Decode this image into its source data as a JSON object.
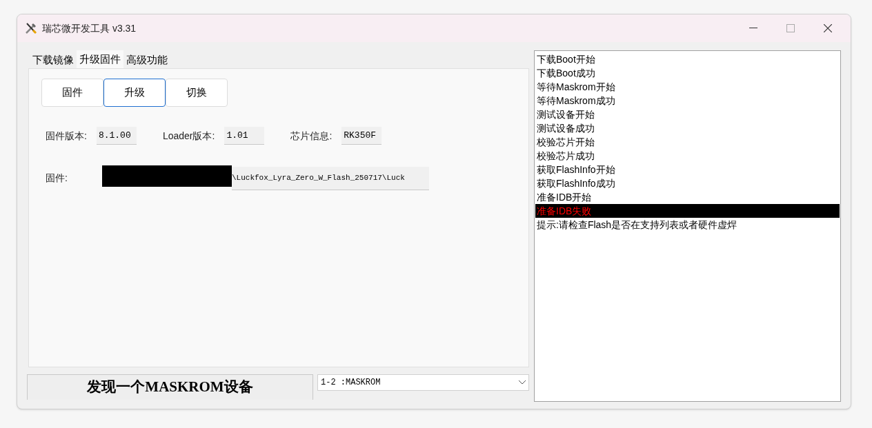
{
  "window": {
    "title": "瑞芯微开发工具 v3.31"
  },
  "tabs": [
    {
      "label": "下载镜像",
      "selected": false
    },
    {
      "label": "升级固件",
      "selected": true
    },
    {
      "label": "高级功能",
      "selected": false
    }
  ],
  "buttons": [
    {
      "label": "固件",
      "selected": false
    },
    {
      "label": "升级",
      "selected": true
    },
    {
      "label": "切换",
      "selected": false
    }
  ],
  "info": [
    {
      "label": "固件版本:",
      "value": "8.1.00"
    },
    {
      "label": "Loader版本:",
      "value": "1.01"
    },
    {
      "label": "芯片信息:",
      "value": "RK350F"
    }
  ],
  "firmware": {
    "label": "固件:",
    "value": "\\Luckfox_Lyra_Zero_W_Flash_250717\\Luck"
  },
  "status": "发现一个MASKROM设备",
  "device_select": {
    "value": "1-2 :MASKROM"
  },
  "log": [
    {
      "text": "下载Boot开始",
      "selected": false,
      "color": "#000000"
    },
    {
      "text": "下载Boot成功",
      "selected": false,
      "color": "#000000"
    },
    {
      "text": "等待Maskrom开始",
      "selected": false,
      "color": "#000000"
    },
    {
      "text": "等待Maskrom成功",
      "selected": false,
      "color": "#000000"
    },
    {
      "text": "测试设备开始",
      "selected": false,
      "color": "#000000"
    },
    {
      "text": "测试设备成功",
      "selected": false,
      "color": "#000000"
    },
    {
      "text": "校验芯片开始",
      "selected": false,
      "color": "#000000"
    },
    {
      "text": "校验芯片成功",
      "selected": false,
      "color": "#000000"
    },
    {
      "text": "获取FlashInfo开始",
      "selected": false,
      "color": "#000000"
    },
    {
      "text": "获取FlashInfo成功",
      "selected": false,
      "color": "#000000"
    },
    {
      "text": "准备IDB开始",
      "selected": false,
      "color": "#000000"
    },
    {
      "text": "准备IDB失败",
      "selected": true,
      "color": "#ff0000"
    },
    {
      "text": "提示:请检查Flash是否在支持列表或者硬件虚焊",
      "selected": false,
      "color": "#000000"
    }
  ]
}
